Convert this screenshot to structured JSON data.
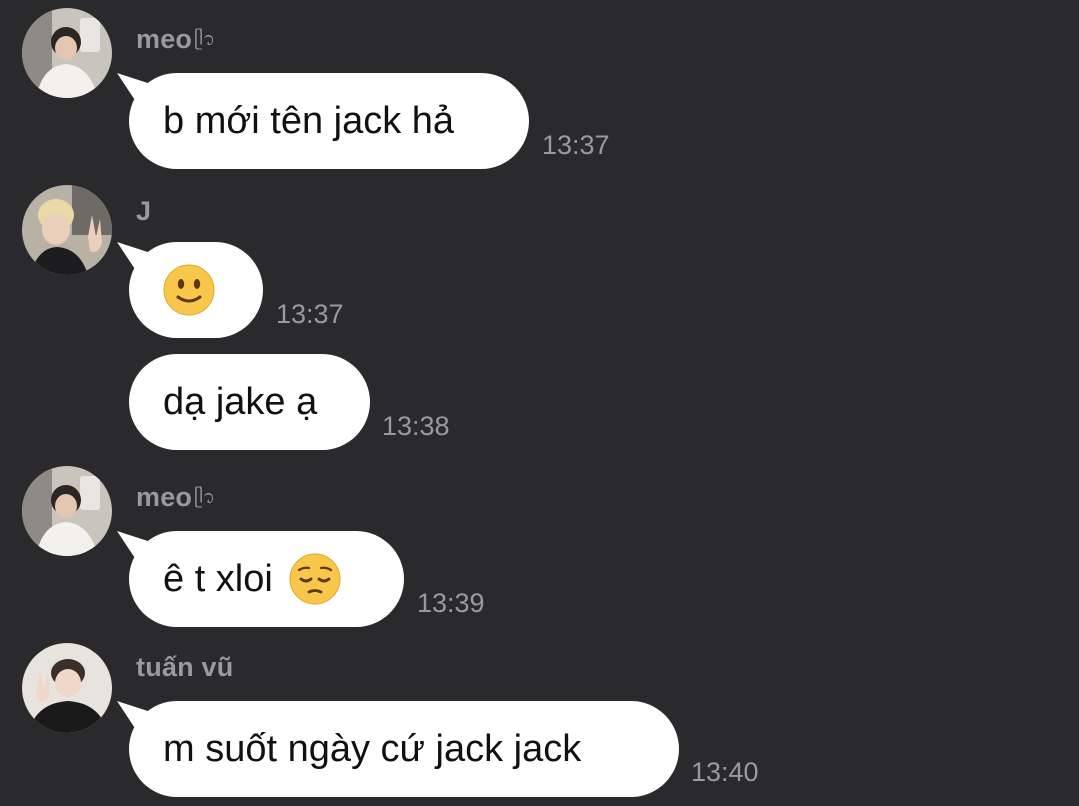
{
  "messages": [
    {
      "sender": "meo",
      "sender_deco": "ᥫ᭡",
      "text": "b mới tên jack hả",
      "time": "13:37",
      "emoji": ""
    },
    {
      "sender": "J",
      "text": "",
      "time": "13:37",
      "emoji": "slightly-smiling-face-emoji"
    },
    {
      "sender": "",
      "text": "dạ jake ạ",
      "time": "13:38",
      "emoji": ""
    },
    {
      "sender": "meo",
      "sender_deco": "ᥫ᭡",
      "text": "ê t xloi ",
      "time": "13:39",
      "emoji": "pensive-face-emoji"
    },
    {
      "sender": "tuấn vũ",
      "text": "m suốt ngày cứ jack jack",
      "time": "13:40",
      "emoji": ""
    }
  ],
  "colors": {
    "background": "#2a2a2c",
    "bubble": "#ffffff",
    "meta_text": "#9a9a9e",
    "emoji_yellow": "#f7c64a"
  }
}
